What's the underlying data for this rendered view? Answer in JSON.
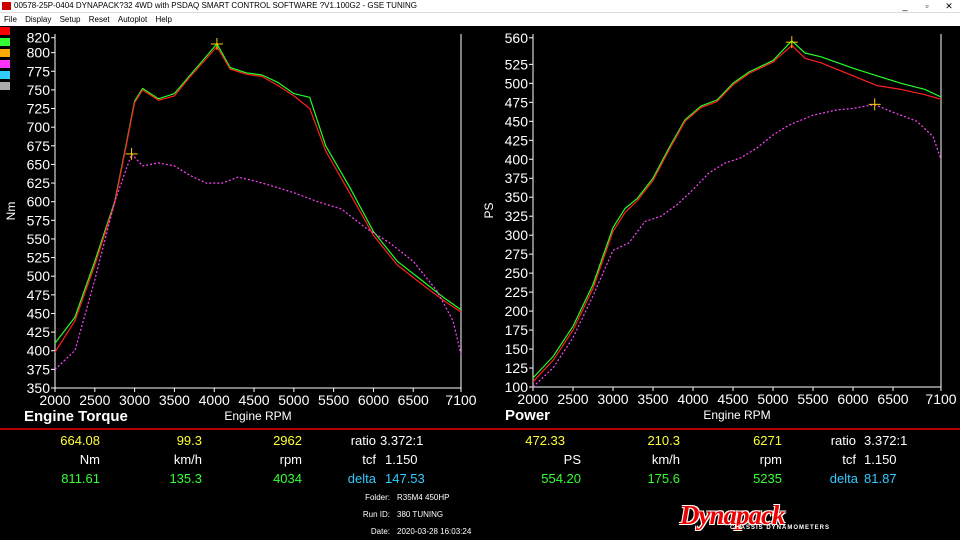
{
  "window": {
    "title": "00578-25P-0404 DYNAPACK?32 4WD with PSDAQ SMART CONTROL SOFTWARE ?V1.100G2 - GSE TUNING",
    "minimize": "_",
    "restore": "▫",
    "close": "✕"
  },
  "menu": [
    "File",
    "Display",
    "Setup",
    "Reset",
    "Autoplot",
    "Help"
  ],
  "swatch_colors": [
    "#ff0000",
    "#33ff33",
    "#ffaa00",
    "#ff33ff",
    "#33ccff",
    "#aaaaaa"
  ],
  "colors": {
    "red": "#ff2020",
    "green": "#22ff22",
    "yellow": "#ffd000",
    "magenta": "#ff44ff"
  },
  "torque_panel": {
    "title": "Engine Torque",
    "readout_row1": [
      "664.08",
      "99.3",
      "2962"
    ],
    "units": [
      "Nm",
      "km/h",
      "rpm"
    ],
    "readout_row2": [
      "811.61",
      "135.3",
      "4034"
    ],
    "ratio_label": "ratio",
    "ratio_value": "3.372:1",
    "tcf_label": "tcf",
    "tcf_value": "1.150",
    "delta_label": "delta",
    "delta_value": "147.53"
  },
  "power_panel": {
    "title": "Power",
    "readout_row1": [
      "472.33",
      "210.3",
      "6271"
    ],
    "units": [
      "PS",
      "km/h",
      "rpm"
    ],
    "readout_row2": [
      "554.20",
      "175.6",
      "5235"
    ],
    "ratio_label": "ratio",
    "ratio_value": "3.372:1",
    "tcf_label": "tcf",
    "tcf_value": "1.150",
    "delta_label": "delta",
    "delta_value": "81.87"
  },
  "run_info": {
    "folder_label": "Folder:",
    "folder_value": "R35M4 450HP",
    "runid_label": "Run ID:",
    "runid_value": "380 TUNING",
    "date_label": "Date:",
    "date_value": "2020-03-28 16:03:24"
  },
  "logo": {
    "word": "Dynapack",
    "sub": "CHASSIS DYNAMOMETERS"
  },
  "chart_data": [
    {
      "type": "line",
      "xlabel": "Engine RPM",
      "ylabel": "Nm",
      "xlim": [
        2000,
        7100
      ],
      "ylim": [
        350,
        825
      ],
      "xticks": [
        2000,
        2500,
        3000,
        3500,
        4000,
        4500,
        5000,
        5500,
        6000,
        6500,
        7100
      ],
      "yticks": [
        350,
        375,
        400,
        425,
        450,
        475,
        500,
        525,
        550,
        575,
        600,
        625,
        650,
        675,
        700,
        725,
        750,
        775,
        800,
        820
      ],
      "grid": false,
      "cursors": [
        {
          "x": 2962,
          "y": 664.08
        },
        {
          "x": 4034,
          "y": 811.61
        }
      ],
      "series": [
        {
          "color": "#22ff22",
          "style": "solid",
          "x": [
            2000,
            2250,
            2500,
            2750,
            2900,
            3000,
            3100,
            3200,
            3300,
            3500,
            3700,
            3900,
            4034,
            4200,
            4400,
            4600,
            4800,
            5000,
            5200,
            5400,
            5700,
            6000,
            6300,
            6600,
            6900,
            7100
          ],
          "y": [
            410,
            445,
            520,
            600,
            680,
            735,
            752,
            745,
            738,
            745,
            770,
            795,
            812,
            780,
            773,
            770,
            760,
            745,
            740,
            675,
            620,
            560,
            520,
            495,
            470,
            455
          ]
        },
        {
          "color": "#ff2020",
          "style": "solid",
          "x": [
            2000,
            2250,
            2500,
            2750,
            2900,
            3000,
            3100,
            3200,
            3300,
            3500,
            3700,
            3900,
            4034,
            4200,
            4400,
            4600,
            4800,
            5000,
            5200,
            5400,
            5700,
            6000,
            6300,
            6600,
            6900,
            7100
          ],
          "y": [
            398,
            440,
            515,
            598,
            678,
            733,
            750,
            743,
            736,
            742,
            768,
            792,
            808,
            778,
            771,
            768,
            756,
            742,
            725,
            668,
            612,
            555,
            515,
            490,
            466,
            452
          ]
        },
        {
          "color": "#ff44ff",
          "style": "dotted",
          "x": [
            2000,
            2250,
            2500,
            2750,
            2962,
            3100,
            3300,
            3500,
            3700,
            3900,
            4100,
            4300,
            4500,
            4700,
            5000,
            5300,
            5600,
            5900,
            6200,
            6500,
            6800,
            7000,
            7100
          ],
          "y": [
            375,
            400,
            495,
            600,
            664,
            648,
            652,
            648,
            635,
            625,
            625,
            633,
            628,
            622,
            612,
            600,
            590,
            565,
            545,
            520,
            480,
            440,
            395
          ]
        }
      ]
    },
    {
      "type": "line",
      "xlabel": "Engine RPM",
      "ylabel": "PS",
      "xlim": [
        2000,
        7100
      ],
      "ylim": [
        100,
        565
      ],
      "xticks": [
        2000,
        2500,
        3000,
        3500,
        4000,
        4500,
        5000,
        5500,
        6000,
        6500,
        7100
      ],
      "yticks": [
        100,
        125,
        150,
        175,
        200,
        225,
        250,
        275,
        300,
        325,
        350,
        375,
        400,
        425,
        450,
        475,
        500,
        525,
        560
      ],
      "grid": false,
      "cursors": [
        {
          "x": 5235,
          "y": 554.2
        },
        {
          "x": 6271,
          "y": 472.33
        }
      ],
      "series": [
        {
          "color": "#22ff22",
          "style": "solid",
          "x": [
            2000,
            2250,
            2500,
            2750,
            3000,
            3150,
            3300,
            3500,
            3700,
            3900,
            4100,
            4300,
            4500,
            4700,
            5000,
            5235,
            5400,
            5600,
            6000,
            6300,
            6600,
            6900,
            7100
          ],
          "y": [
            112,
            140,
            180,
            235,
            310,
            335,
            348,
            375,
            415,
            452,
            470,
            478,
            500,
            515,
            530,
            556,
            540,
            535,
            520,
            510,
            500,
            492,
            482
          ]
        },
        {
          "color": "#ff2020",
          "style": "solid",
          "x": [
            2000,
            2250,
            2500,
            2750,
            3000,
            3150,
            3300,
            3500,
            3700,
            3900,
            4100,
            4300,
            4500,
            4700,
            5000,
            5235,
            5400,
            5600,
            6000,
            6300,
            6600,
            6900,
            7100
          ],
          "y": [
            107,
            135,
            175,
            230,
            305,
            330,
            345,
            372,
            412,
            450,
            468,
            476,
            498,
            513,
            528,
            550,
            533,
            527,
            510,
            497,
            492,
            485,
            479
          ]
        },
        {
          "color": "#ff44ff",
          "style": "dotted",
          "x": [
            2000,
            2250,
            2500,
            2750,
            3000,
            3200,
            3400,
            3600,
            3800,
            4000,
            4200,
            4400,
            4600,
            4800,
            5000,
            5200,
            5500,
            5800,
            6000,
            6271,
            6500,
            6800,
            7000,
            7100
          ],
          "y": [
            100,
            125,
            165,
            220,
            280,
            290,
            318,
            325,
            340,
            360,
            382,
            395,
            402,
            415,
            432,
            445,
            458,
            465,
            467,
            472,
            462,
            450,
            430,
            400
          ]
        }
      ]
    }
  ]
}
